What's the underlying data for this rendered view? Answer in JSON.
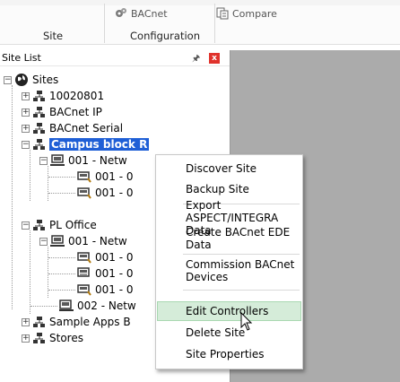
{
  "ribbon": {
    "bacnet_label": "BACnet",
    "compare_label": "Compare",
    "site_group": "Site",
    "configuration_group": "Configuration"
  },
  "site_list": {
    "title": "Site List",
    "pin_icon": "pin-icon",
    "close_label": "x"
  },
  "tree": {
    "root": "Sites",
    "nodes": [
      {
        "label": "10020801"
      },
      {
        "label": "BACnet IP"
      },
      {
        "label": "BACnet Serial"
      },
      {
        "label": "Campus block R"
      },
      {
        "label": "001 - Netw"
      },
      {
        "label": "001 - 0"
      },
      {
        "label": "001 - 0"
      },
      {
        "label": "PL Office"
      },
      {
        "label": "001 - Netw"
      },
      {
        "label": "001 - 0"
      },
      {
        "label": "001 - 0"
      },
      {
        "label": "001 - 0"
      },
      {
        "label": "002 - Netw"
      },
      {
        "label": "Sample Apps B"
      },
      {
        "label": "Stores"
      }
    ]
  },
  "context_menu": {
    "items": [
      "Discover Site",
      "Backup Site",
      "Export ASPECT/INTEGRA Data",
      "Create BACnet EDE Data",
      "Commission BACnet Devices",
      "Edit Controllers",
      "Delete Site",
      "Site Properties"
    ],
    "hovered": "Edit Controllers"
  },
  "colors": {
    "selection": "#1f5fd6",
    "hover": "#d5ecd9",
    "pane_background": "#ababab",
    "close_button": "#e0322c"
  }
}
